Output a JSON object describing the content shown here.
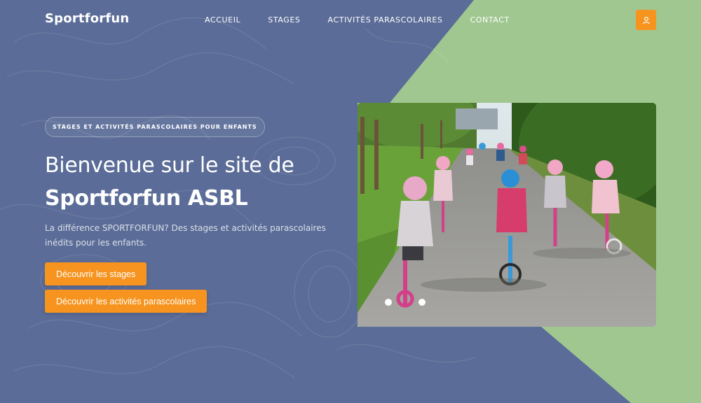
{
  "brand": {
    "name": "Sportforfun"
  },
  "nav": {
    "items": [
      {
        "label": "ACCUEIL"
      },
      {
        "label": "STAGES"
      },
      {
        "label": "ACTIVITÉS PARASCOLAIRES"
      },
      {
        "label": "CONTACT"
      }
    ]
  },
  "account": {
    "icon": "user-icon"
  },
  "hero": {
    "badge": "STAGES ET ACTIVITÉS PARASCOLAIRES POUR ENFANTS",
    "title_line1": "Bienvenue sur le site de",
    "title_line2": "Sportforfun ASBL",
    "description": "La différence SPORTFORFUN? Des stages et activités parascolaires inédits pour les enfants.",
    "cta_primary": "Découvrir les stages",
    "cta_secondary": "Découvrir les activités parascolaires"
  },
  "colors": {
    "background_blue": "#5a6c97",
    "accent_green": "#a1c791",
    "button_orange": "#f6941f"
  }
}
